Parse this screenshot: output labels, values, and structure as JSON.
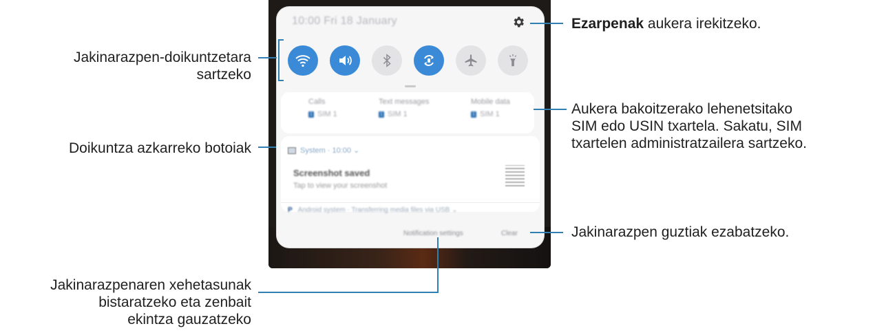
{
  "phone": {
    "status_bar": {
      "text": "10:00 Fri 18 January",
      "settings_icon": "gear-icon"
    },
    "quick_settings": [
      {
        "name": "wifi",
        "icon": "wifi-icon",
        "on": true
      },
      {
        "name": "sound",
        "icon": "volume-icon",
        "on": true
      },
      {
        "name": "bluetooth",
        "icon": "bluetooth-icon",
        "on": false
      },
      {
        "name": "auto-rotate",
        "icon": "rotate-icon",
        "on": true
      },
      {
        "name": "airplane",
        "icon": "airplane-icon",
        "on": false
      },
      {
        "name": "flashlight",
        "icon": "flashlight-icon",
        "on": false
      }
    ],
    "sim_preferences": [
      {
        "title": "Calls",
        "value": "SIM 1"
      },
      {
        "title": "Text messages",
        "value": "SIM 1"
      },
      {
        "title": "Mobile data",
        "value": "SIM 1"
      }
    ],
    "notification": {
      "app": "System · 10:00",
      "title": "Screenshot saved",
      "body": "Tap to view your screenshot"
    },
    "system_row": {
      "app": "Android system",
      "text": "Transferring media files via USB"
    },
    "footer": {
      "settings_button": "Notification settings",
      "clear_button": "Clear"
    }
  },
  "callouts": {
    "settings_bold": "Ezarpenak",
    "settings_rest": " aukera irekitzeko.",
    "notif_settings_line1": "Jakinarazpen-doikuntzetara",
    "notif_settings_line2": "sartzeko",
    "sim_line1": "Aukera bakoitzerako lehenetsitako",
    "sim_line2": "SIM edo USIN txartela. Sakatu, SIM",
    "sim_line3": "txartelen administratzailera sartzeko.",
    "quick_buttons": "Doikuntza azkarreko botoiak",
    "clear_all": "Jakinarazpen guztiak ezabatzeko.",
    "details_line1": "Jakinarazpenaren xehetasunak",
    "details_line2": "bistaratzeko eta zenbait",
    "details_line3": "ekintza gauzatzeko"
  },
  "colors": {
    "accent": "#3a8ad7",
    "callout_line": "#2f7fb3"
  }
}
